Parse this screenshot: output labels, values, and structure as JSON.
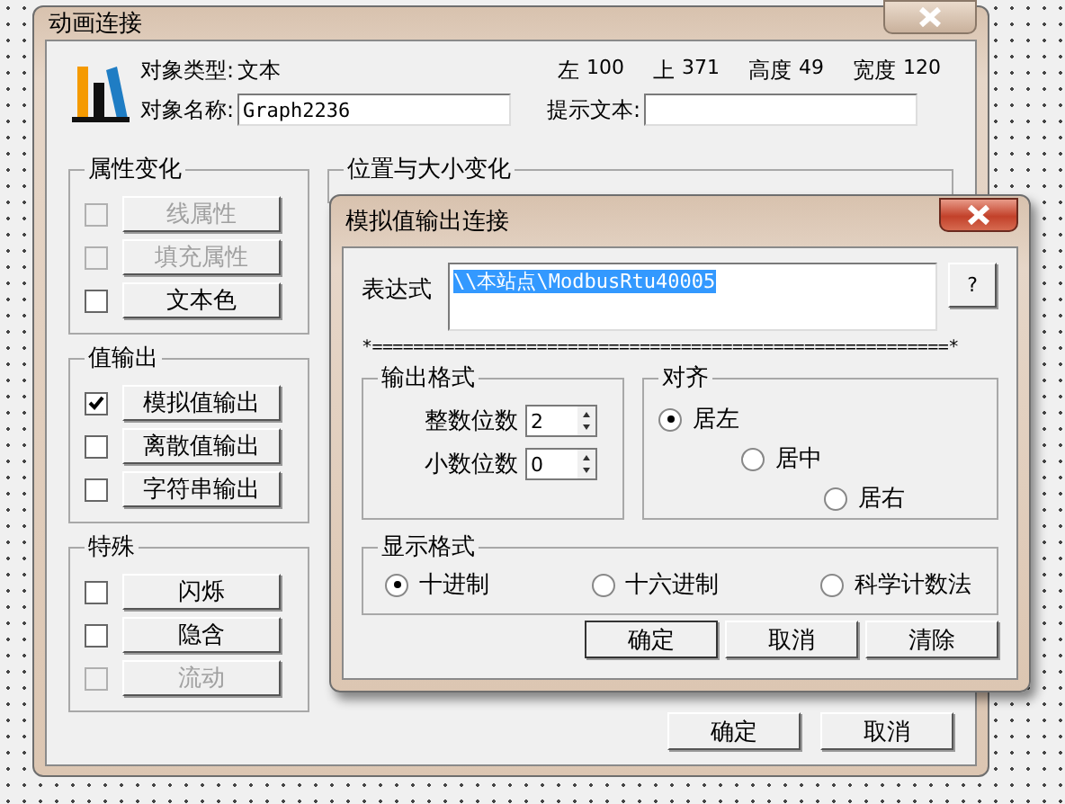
{
  "window": {
    "title": "动画连接"
  },
  "object_info": {
    "type_label": "对象类型:",
    "type_value": "文本",
    "name_label": "对象名称:",
    "name_value": "Graph2236",
    "tip_label": "提示文本:"
  },
  "position": [
    {
      "label": "左",
      "value": "100"
    },
    {
      "label": "上",
      "value": "371"
    },
    {
      "label": "高度",
      "value": "49"
    },
    {
      "label": "宽度",
      "value": "120"
    }
  ],
  "groups": [
    {
      "title": "属性变化",
      "items": [
        {
          "label": "线属性",
          "checked": false,
          "disabled": true
        },
        {
          "label": "填充属性",
          "checked": false,
          "disabled": true
        },
        {
          "label": "文本色",
          "checked": false,
          "disabled": false
        }
      ]
    },
    {
      "title": "值输出",
      "items": [
        {
          "label": "模拟值输出",
          "checked": true,
          "disabled": false
        },
        {
          "label": "离散值输出",
          "checked": false,
          "disabled": false
        },
        {
          "label": "字符串输出",
          "checked": false,
          "disabled": false
        }
      ]
    },
    {
      "title": "特殊",
      "items": [
        {
          "label": "闪烁",
          "checked": false,
          "disabled": false
        },
        {
          "label": "隐含",
          "checked": false,
          "disabled": false
        },
        {
          "label": "流动",
          "checked": false,
          "disabled": true
        }
      ]
    }
  ],
  "position_group": {
    "title": "位置与大小变化"
  },
  "buttons": [
    "确定",
    "取消"
  ],
  "dialog": {
    "title": "模拟值输出连接",
    "expression_label": "表达式",
    "expression": "\\\\本站点\\ModbusRtu40005",
    "expression_selected": true,
    "help_button": "?",
    "separator": "*========================================================*",
    "output_format": {
      "title": "输出格式",
      "fields": [
        {
          "label": "整数位数",
          "value": "2"
        },
        {
          "label": "小数位数",
          "value": "0"
        }
      ]
    },
    "align": {
      "title": "对齐",
      "options": [
        {
          "label": "居左",
          "selected": true
        },
        {
          "label": "居中",
          "selected": false
        },
        {
          "label": "居右",
          "selected": false
        }
      ]
    },
    "display_format": {
      "title": "显示格式",
      "options": [
        {
          "label": "十进制",
          "selected": true
        },
        {
          "label": "十六进制",
          "selected": false
        },
        {
          "label": "科学计数法",
          "selected": false
        }
      ]
    },
    "buttons": [
      "确定",
      "取消",
      "清除"
    ]
  }
}
